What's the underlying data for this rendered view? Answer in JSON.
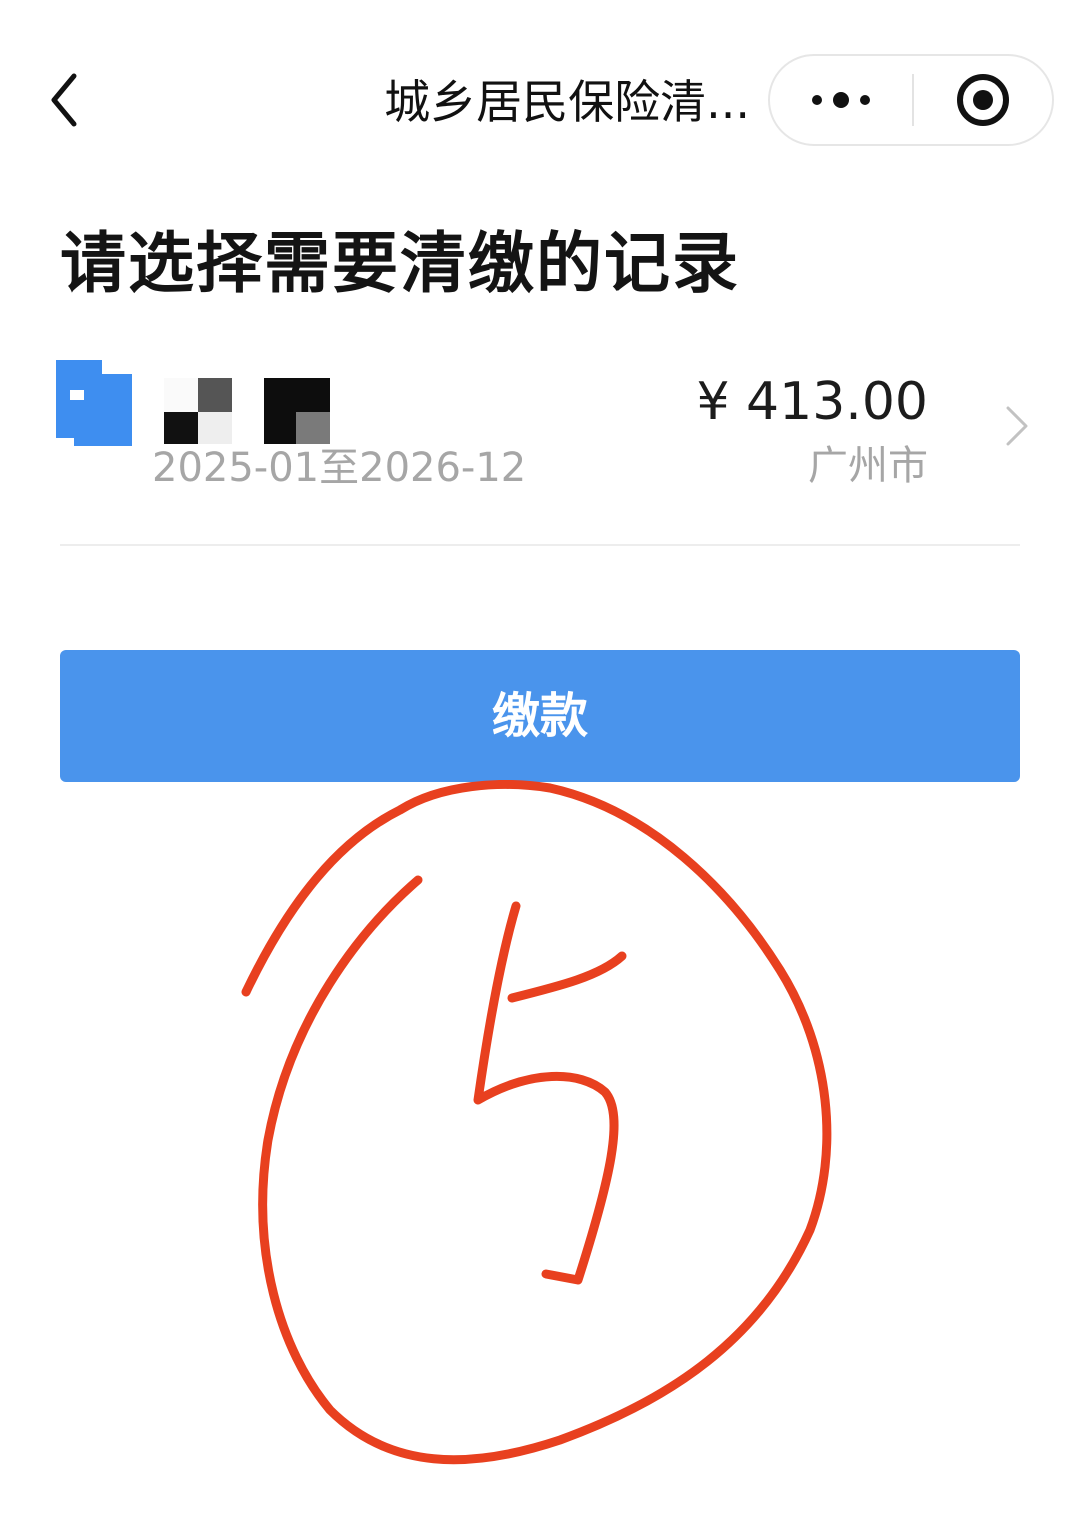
{
  "nav": {
    "title": "城乡居民保险清...",
    "back_icon": "chevron-left-icon",
    "more_icon": "more-dots-icon",
    "close_icon": "target-circle-icon"
  },
  "heading": "请选择需要清缴的记录",
  "record": {
    "period": "2025-01至2026-12",
    "amount": "¥ 413.00",
    "city": "广州市",
    "icon": "id-card-icon",
    "arrow_icon": "chevron-right-icon"
  },
  "pay_button": {
    "label": "缴款"
  },
  "annotation": {
    "handwritten": "5",
    "color": "#e8401f"
  },
  "colors": {
    "accent": "#4a94ec",
    "secondary_text": "#a6a6a6"
  }
}
